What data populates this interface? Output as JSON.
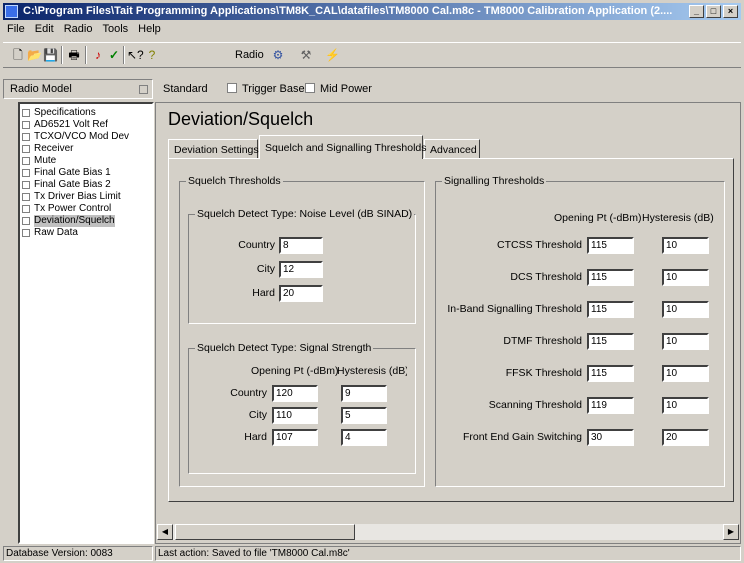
{
  "window": {
    "title": "C:\\Program Files\\Tait Programming Applications\\TM8K_CAL\\datafiles\\TM8000 Cal.m8c - TM8000 Calibration Application (2....",
    "controls": [
      "minimize-icon",
      "maximize-icon",
      "close-icon"
    ]
  },
  "menu": [
    "File",
    "Edit",
    "Radio",
    "Tools",
    "Help"
  ],
  "toolbar": {
    "radio_label": "Radio",
    "icons": [
      "new-icon",
      "open-icon",
      "save-icon",
      "print-icon",
      "read-radio-icon",
      "check-icon",
      "context-help-icon",
      "help-icon",
      "radio-read-icon",
      "radio-write-icon",
      "radio-program-icon"
    ]
  },
  "modelbar": {
    "radio_model": "Radio Model",
    "items": [
      "Standard",
      "Trigger Base",
      "Mid Power"
    ]
  },
  "tree": {
    "items": [
      "Specifications",
      "AD6521 Volt Ref",
      "TCXO/VCO Mod Dev",
      "Receiver",
      "Mute",
      "Final Gate Bias 1",
      "Final Gate Bias 2",
      "Tx Driver Bias Limit",
      "Tx Power Control",
      "Deviation/Squelch",
      "Raw Data"
    ],
    "selected": "Deviation/Squelch"
  },
  "page": {
    "heading": "Deviation/Squelch",
    "tabs": [
      "Deviation Settings",
      "Squelch and Signalling Thresholds",
      "Advanced"
    ],
    "active_tab": "Squelch and Signalling Thresholds"
  },
  "squelch": {
    "title": "Squelch Thresholds",
    "noise": {
      "title": "Squelch Detect Type: Noise Level (dB SINAD)",
      "rows": [
        {
          "label": "Country",
          "value": "8"
        },
        {
          "label": "City",
          "value": "12"
        },
        {
          "label": "Hard",
          "value": "20"
        }
      ]
    },
    "signal": {
      "title": "Squelch Detect Type: Signal Strength",
      "col_opening": "Opening Pt (-dBm)",
      "col_hysteresis": "Hysteresis (dB)",
      "rows": [
        {
          "label": "Country",
          "opening": "120",
          "hysteresis": "9"
        },
        {
          "label": "City",
          "opening": "110",
          "hysteresis": "5"
        },
        {
          "label": "Hard",
          "opening": "107",
          "hysteresis": "4"
        }
      ]
    }
  },
  "signalling": {
    "title": "Signalling Thresholds",
    "col_opening": "Opening Pt (-dBm)",
    "col_hysteresis": "Hysteresis (dB)",
    "rows": [
      {
        "label": "CTCSS Threshold",
        "opening": "115",
        "hysteresis": "10"
      },
      {
        "label": "DCS Threshold",
        "opening": "115",
        "hysteresis": "10"
      },
      {
        "label": "In-Band Signalling Threshold",
        "opening": "115",
        "hysteresis": "10"
      },
      {
        "label": "DTMF Threshold",
        "opening": "115",
        "hysteresis": "10"
      },
      {
        "label": "FFSK Threshold",
        "opening": "115",
        "hysteresis": "10"
      },
      {
        "label": "Scanning Threshold",
        "opening": "119",
        "hysteresis": "10"
      },
      {
        "label": "Front End Gain Switching",
        "opening": "30",
        "hysteresis": "20"
      }
    ]
  },
  "status": {
    "db_version": "Database Version: 0083",
    "last_action": "Last action: Saved to file 'TM8000 Cal.m8c'"
  }
}
